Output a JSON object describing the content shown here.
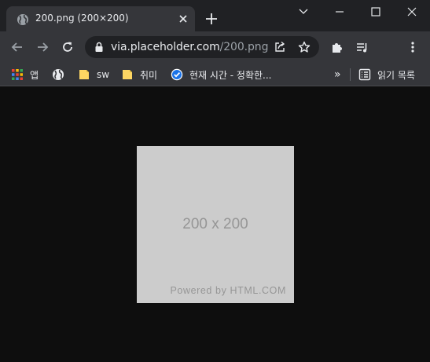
{
  "tab": {
    "title": "200.png (200×200)",
    "favicon": "globe-icon",
    "close": "close-icon"
  },
  "window_controls": [
    "chevron-down-icon",
    "minimize-icon",
    "maximize-icon",
    "close-icon"
  ],
  "toolbar": {
    "back": "back-arrow-icon",
    "forward": "forward-arrow-icon",
    "reload": "reload-icon",
    "url_host": "via.placeholder.com",
    "url_path": "/200.png",
    "extensions": "puzzle-icon",
    "media": "media-queue-icon",
    "menu": "kebab-menu-icon"
  },
  "bookmarks": {
    "items": [
      {
        "label": "앱",
        "icon": "apps-grid-icon"
      },
      {
        "label": "",
        "icon": "globe-icon"
      },
      {
        "label": "sw",
        "icon": "folder-icon"
      },
      {
        "label": "취미",
        "icon": "folder-icon"
      },
      {
        "label": "현재 시간 - 정확한...",
        "icon": "clock-icon"
      }
    ],
    "overflow": "»",
    "reading_list": "읽기 목록"
  },
  "image": {
    "dimensions_text": "200 x 200",
    "powered_text": "Powered by HTML.COM",
    "background": "#cccccc",
    "text_color": "#969696"
  },
  "colors": {
    "tabstrip": "#202124",
    "toolbar": "#35363a",
    "page_background": "#0e0e0e"
  }
}
